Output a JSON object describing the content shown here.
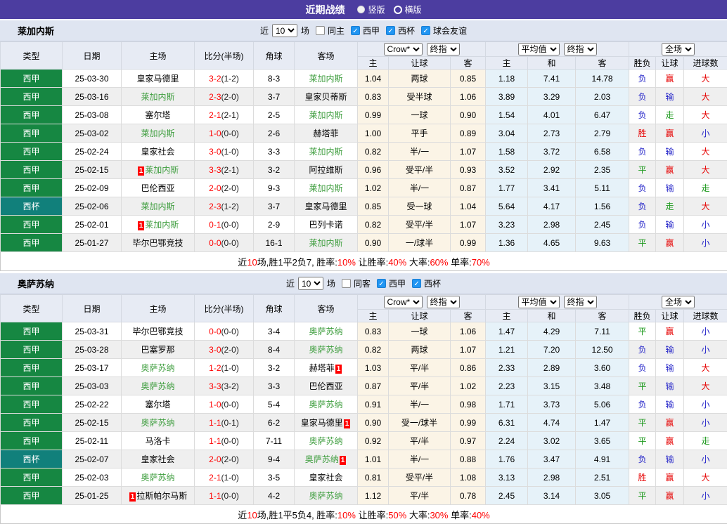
{
  "title_bar": {
    "title": "近期战绩",
    "options": [
      {
        "label": "竖版",
        "selected": true
      },
      {
        "label": "横版",
        "selected": false
      }
    ]
  },
  "table_headers": {
    "cols": [
      "类型",
      "日期",
      "主场",
      "比分(半场)",
      "角球",
      "客场"
    ],
    "handicap_sub": [
      "主",
      "让球",
      "客"
    ],
    "europe_sub": [
      "主",
      "和",
      "客"
    ],
    "result_sub": [
      "胜负",
      "让球",
      "进球数"
    ]
  },
  "colors": {
    "title_purple": "#4c3da0",
    "league_green": "#168742",
    "cup_teal": "#11807b",
    "focus_team_green": "#3f9e3f",
    "score_red": "#ff0000",
    "result_red": "#e60000",
    "result_blue": "#2626c9",
    "result_green": "#1f9a1f",
    "checkbox_blue": "#2196f3",
    "let_col_bg": "#fbf4e6",
    "avg_col_bg": "#e6f2f9"
  },
  "sections": [
    {
      "team": "莱加内斯",
      "filter": {
        "prefix": "近",
        "count": "10",
        "suffix": "场",
        "checkboxes": [
          {
            "label": "同主",
            "checked": false
          },
          {
            "label": "西甲",
            "checked": true
          },
          {
            "label": "西杯",
            "checked": true
          },
          {
            "label": "球会友谊",
            "checked": true
          }
        ]
      },
      "selects": {
        "handicap": [
          "Crow*",
          "终指"
        ],
        "europe": [
          "平均值",
          "终指"
        ],
        "result": [
          "全场"
        ]
      },
      "rows": [
        {
          "league": "西甲",
          "cup": false,
          "date": "25-03-30",
          "home": {
            "name": "皇家马德里"
          },
          "score": "3-2",
          "half": "(1-2)",
          "corner": "8-3",
          "away": {
            "name": "莱加内斯",
            "focus": true
          },
          "let": [
            "1.04",
            "两球",
            "0.85"
          ],
          "avg": [
            "1.18",
            "7.41",
            "14.78"
          ],
          "result": [
            {
              "t": "负",
              "c": "b"
            },
            {
              "t": "赢",
              "c": "r"
            },
            {
              "t": "大",
              "c": "r"
            }
          ]
        },
        {
          "league": "西甲",
          "cup": false,
          "date": "25-03-16",
          "home": {
            "name": "莱加内斯",
            "focus": true
          },
          "score": "2-3",
          "half": "(2-0)",
          "corner": "3-7",
          "away": {
            "name": "皇家贝蒂斯"
          },
          "let": [
            "0.83",
            "受半球",
            "1.06"
          ],
          "avg": [
            "3.89",
            "3.29",
            "2.03"
          ],
          "result": [
            {
              "t": "负",
              "c": "b"
            },
            {
              "t": "输",
              "c": "b"
            },
            {
              "t": "大",
              "c": "r"
            }
          ]
        },
        {
          "league": "西甲",
          "cup": false,
          "date": "25-03-08",
          "home": {
            "name": "塞尔塔"
          },
          "score": "2-1",
          "half": "(2-1)",
          "corner": "2-5",
          "away": {
            "name": "莱加内斯",
            "focus": true
          },
          "let": [
            "0.99",
            "一球",
            "0.90"
          ],
          "avg": [
            "1.54",
            "4.01",
            "6.47"
          ],
          "result": [
            {
              "t": "负",
              "c": "b"
            },
            {
              "t": "走",
              "c": "g"
            },
            {
              "t": "大",
              "c": "r"
            }
          ]
        },
        {
          "league": "西甲",
          "cup": false,
          "date": "25-03-02",
          "home": {
            "name": "莱加内斯",
            "focus": true
          },
          "score": "1-0",
          "half": "(0-0)",
          "corner": "2-6",
          "away": {
            "name": "赫塔菲"
          },
          "let": [
            "1.00",
            "平手",
            "0.89"
          ],
          "avg": [
            "3.04",
            "2.73",
            "2.79"
          ],
          "result": [
            {
              "t": "胜",
              "c": "r"
            },
            {
              "t": "赢",
              "c": "r"
            },
            {
              "t": "小",
              "c": "b"
            }
          ]
        },
        {
          "league": "西甲",
          "cup": false,
          "date": "25-02-24",
          "home": {
            "name": "皇家社会"
          },
          "score": "3-0",
          "half": "(1-0)",
          "corner": "3-3",
          "away": {
            "name": "莱加内斯",
            "focus": true
          },
          "let": [
            "0.82",
            "半/一",
            "1.07"
          ],
          "avg": [
            "1.58",
            "3.72",
            "6.58"
          ],
          "result": [
            {
              "t": "负",
              "c": "b"
            },
            {
              "t": "输",
              "c": "b"
            },
            {
              "t": "大",
              "c": "r"
            }
          ]
        },
        {
          "league": "西甲",
          "cup": false,
          "date": "25-02-15",
          "home": {
            "name": "莱加内斯",
            "focus": true,
            "rc": "1",
            "rc_pos": "before"
          },
          "score": "3-3",
          "half": "(2-1)",
          "corner": "3-2",
          "away": {
            "name": "阿拉维斯"
          },
          "let": [
            "0.96",
            "受平/半",
            "0.93"
          ],
          "avg": [
            "3.52",
            "2.92",
            "2.35"
          ],
          "result": [
            {
              "t": "平",
              "c": "g"
            },
            {
              "t": "赢",
              "c": "r"
            },
            {
              "t": "大",
              "c": "r"
            }
          ]
        },
        {
          "league": "西甲",
          "cup": false,
          "date": "25-02-09",
          "home": {
            "name": "巴伦西亚"
          },
          "score": "2-0",
          "half": "(2-0)",
          "corner": "9-3",
          "away": {
            "name": "莱加内斯",
            "focus": true
          },
          "let": [
            "1.02",
            "半/一",
            "0.87"
          ],
          "avg": [
            "1.77",
            "3.41",
            "5.11"
          ],
          "result": [
            {
              "t": "负",
              "c": "b"
            },
            {
              "t": "输",
              "c": "b"
            },
            {
              "t": "走",
              "c": "g"
            }
          ]
        },
        {
          "league": "西杯",
          "cup": true,
          "date": "25-02-06",
          "home": {
            "name": "莱加内斯",
            "focus": true
          },
          "score": "2-3",
          "half": "(1-2)",
          "corner": "3-7",
          "away": {
            "name": "皇家马德里"
          },
          "let": [
            "0.85",
            "受一球",
            "1.04"
          ],
          "avg": [
            "5.64",
            "4.17",
            "1.56"
          ],
          "result": [
            {
              "t": "负",
              "c": "b"
            },
            {
              "t": "走",
              "c": "g"
            },
            {
              "t": "大",
              "c": "r"
            }
          ]
        },
        {
          "league": "西甲",
          "cup": false,
          "date": "25-02-01",
          "home": {
            "name": "莱加内斯",
            "focus": true,
            "rc": "1",
            "rc_pos": "before"
          },
          "score": "0-1",
          "half": "(0-0)",
          "corner": "2-9",
          "away": {
            "name": "巴列卡诺"
          },
          "let": [
            "0.82",
            "受平/半",
            "1.07"
          ],
          "avg": [
            "3.23",
            "2.98",
            "2.45"
          ],
          "result": [
            {
              "t": "负",
              "c": "b"
            },
            {
              "t": "输",
              "c": "b"
            },
            {
              "t": "小",
              "c": "b"
            }
          ]
        },
        {
          "league": "西甲",
          "cup": false,
          "date": "25-01-27",
          "home": {
            "name": "毕尔巴鄂竞技"
          },
          "score": "0-0",
          "half": "(0-0)",
          "corner": "16-1",
          "away": {
            "name": "莱加内斯",
            "focus": true
          },
          "let": [
            "0.90",
            "一/球半",
            "0.99"
          ],
          "avg": [
            "1.36",
            "4.65",
            "9.63"
          ],
          "result": [
            {
              "t": "平",
              "c": "g"
            },
            {
              "t": "赢",
              "c": "r"
            },
            {
              "t": "小",
              "c": "b"
            }
          ]
        }
      ],
      "summary": [
        {
          "t": "近",
          "c": "k"
        },
        {
          "t": "10",
          "c": "r"
        },
        {
          "t": "场,胜1平2负7, 胜率:",
          "c": "k"
        },
        {
          "t": "10%",
          "c": "r"
        },
        {
          "t": " 让胜率:",
          "c": "k"
        },
        {
          "t": "40%",
          "c": "r"
        },
        {
          "t": " 大率:",
          "c": "k"
        },
        {
          "t": "60%",
          "c": "r"
        },
        {
          "t": " 单率:",
          "c": "k"
        },
        {
          "t": "70%",
          "c": "r"
        }
      ]
    },
    {
      "team": "奥萨苏纳",
      "filter": {
        "prefix": "近",
        "count": "10",
        "suffix": "场",
        "checkboxes": [
          {
            "label": "同客",
            "checked": false
          },
          {
            "label": "西甲",
            "checked": true
          },
          {
            "label": "西杯",
            "checked": true
          }
        ]
      },
      "selects": {
        "handicap": [
          "Crow*",
          "终指"
        ],
        "europe": [
          "平均值",
          "终指"
        ],
        "result": [
          "全场"
        ]
      },
      "rows": [
        {
          "league": "西甲",
          "cup": false,
          "date": "25-03-31",
          "home": {
            "name": "毕尔巴鄂竞技"
          },
          "score": "0-0",
          "half": "(0-0)",
          "corner": "3-4",
          "away": {
            "name": "奥萨苏纳",
            "focus": true
          },
          "let": [
            "0.83",
            "一球",
            "1.06"
          ],
          "avg": [
            "1.47",
            "4.29",
            "7.11"
          ],
          "result": [
            {
              "t": "平",
              "c": "g"
            },
            {
              "t": "赢",
              "c": "r"
            },
            {
              "t": "小",
              "c": "b"
            }
          ]
        },
        {
          "league": "西甲",
          "cup": false,
          "date": "25-03-28",
          "home": {
            "name": "巴塞罗那"
          },
          "score": "3-0",
          "half": "(2-0)",
          "corner": "8-4",
          "away": {
            "name": "奥萨苏纳",
            "focus": true
          },
          "let": [
            "0.82",
            "两球",
            "1.07"
          ],
          "avg": [
            "1.21",
            "7.20",
            "12.50"
          ],
          "result": [
            {
              "t": "负",
              "c": "b"
            },
            {
              "t": "输",
              "c": "b"
            },
            {
              "t": "小",
              "c": "b"
            }
          ]
        },
        {
          "league": "西甲",
          "cup": false,
          "date": "25-03-17",
          "home": {
            "name": "奥萨苏纳",
            "focus": true
          },
          "score": "1-2",
          "half": "(1-0)",
          "corner": "3-2",
          "away": {
            "name": "赫塔菲",
            "rc": "1",
            "rc_pos": "after"
          },
          "let": [
            "1.03",
            "平/半",
            "0.86"
          ],
          "avg": [
            "2.33",
            "2.89",
            "3.60"
          ],
          "result": [
            {
              "t": "负",
              "c": "b"
            },
            {
              "t": "输",
              "c": "b"
            },
            {
              "t": "大",
              "c": "r"
            }
          ]
        },
        {
          "league": "西甲",
          "cup": false,
          "date": "25-03-03",
          "home": {
            "name": "奥萨苏纳",
            "focus": true
          },
          "score": "3-3",
          "half": "(3-2)",
          "corner": "3-3",
          "away": {
            "name": "巴伦西亚"
          },
          "let": [
            "0.87",
            "平/半",
            "1.02"
          ],
          "avg": [
            "2.23",
            "3.15",
            "3.48"
          ],
          "result": [
            {
              "t": "平",
              "c": "g"
            },
            {
              "t": "输",
              "c": "b"
            },
            {
              "t": "大",
              "c": "r"
            }
          ]
        },
        {
          "league": "西甲",
          "cup": false,
          "date": "25-02-22",
          "home": {
            "name": "塞尔塔"
          },
          "score": "1-0",
          "half": "(0-0)",
          "corner": "5-4",
          "away": {
            "name": "奥萨苏纳",
            "focus": true
          },
          "let": [
            "0.91",
            "半/一",
            "0.98"
          ],
          "avg": [
            "1.71",
            "3.73",
            "5.06"
          ],
          "result": [
            {
              "t": "负",
              "c": "b"
            },
            {
              "t": "输",
              "c": "b"
            },
            {
              "t": "小",
              "c": "b"
            }
          ]
        },
        {
          "league": "西甲",
          "cup": false,
          "date": "25-02-15",
          "home": {
            "name": "奥萨苏纳",
            "focus": true
          },
          "score": "1-1",
          "half": "(0-1)",
          "corner": "6-2",
          "away": {
            "name": "皇家马德里",
            "rc": "1",
            "rc_pos": "after"
          },
          "let": [
            "0.90",
            "受一/球半",
            "0.99"
          ],
          "avg": [
            "6.31",
            "4.74",
            "1.47"
          ],
          "result": [
            {
              "t": "平",
              "c": "g"
            },
            {
              "t": "赢",
              "c": "r"
            },
            {
              "t": "小",
              "c": "b"
            }
          ]
        },
        {
          "league": "西甲",
          "cup": false,
          "date": "25-02-11",
          "home": {
            "name": "马洛卡"
          },
          "score": "1-1",
          "half": "(0-0)",
          "corner": "7-11",
          "away": {
            "name": "奥萨苏纳",
            "focus": true
          },
          "let": [
            "0.92",
            "平/半",
            "0.97"
          ],
          "avg": [
            "2.24",
            "3.02",
            "3.65"
          ],
          "result": [
            {
              "t": "平",
              "c": "g"
            },
            {
              "t": "赢",
              "c": "r"
            },
            {
              "t": "走",
              "c": "g"
            }
          ]
        },
        {
          "league": "西杯",
          "cup": true,
          "date": "25-02-07",
          "home": {
            "name": "皇家社会"
          },
          "score": "2-0",
          "half": "(2-0)",
          "corner": "9-4",
          "away": {
            "name": "奥萨苏纳",
            "focus": true,
            "rc": "1",
            "rc_pos": "after"
          },
          "let": [
            "1.01",
            "半/一",
            "0.88"
          ],
          "avg": [
            "1.76",
            "3.47",
            "4.91"
          ],
          "result": [
            {
              "t": "负",
              "c": "b"
            },
            {
              "t": "输",
              "c": "b"
            },
            {
              "t": "小",
              "c": "b"
            }
          ]
        },
        {
          "league": "西甲",
          "cup": false,
          "date": "25-02-03",
          "home": {
            "name": "奥萨苏纳",
            "focus": true
          },
          "score": "2-1",
          "half": "(1-0)",
          "corner": "3-5",
          "away": {
            "name": "皇家社会"
          },
          "let": [
            "0.81",
            "受平/半",
            "1.08"
          ],
          "avg": [
            "3.13",
            "2.98",
            "2.51"
          ],
          "result": [
            {
              "t": "胜",
              "c": "r"
            },
            {
              "t": "赢",
              "c": "r"
            },
            {
              "t": "大",
              "c": "r"
            }
          ]
        },
        {
          "league": "西甲",
          "cup": false,
          "date": "25-01-25",
          "home": {
            "name": "拉斯帕尔马斯",
            "rc": "1",
            "rc_pos": "before"
          },
          "score": "1-1",
          "half": "(0-0)",
          "corner": "4-2",
          "away": {
            "name": "奥萨苏纳",
            "focus": true
          },
          "let": [
            "1.12",
            "平/半",
            "0.78"
          ],
          "avg": [
            "2.45",
            "3.14",
            "3.05"
          ],
          "result": [
            {
              "t": "平",
              "c": "g"
            },
            {
              "t": "赢",
              "c": "r"
            },
            {
              "t": "小",
              "c": "b"
            }
          ]
        }
      ],
      "summary": [
        {
          "t": "近",
          "c": "k"
        },
        {
          "t": "10",
          "c": "r"
        },
        {
          "t": "场,胜1平5负4, 胜率:",
          "c": "k"
        },
        {
          "t": "10%",
          "c": "r"
        },
        {
          "t": " 让胜率:",
          "c": "k"
        },
        {
          "t": "50%",
          "c": "r"
        },
        {
          "t": " 大率:",
          "c": "k"
        },
        {
          "t": "30%",
          "c": "r"
        },
        {
          "t": " 单率:",
          "c": "k"
        },
        {
          "t": "40%",
          "c": "r"
        }
      ]
    }
  ]
}
